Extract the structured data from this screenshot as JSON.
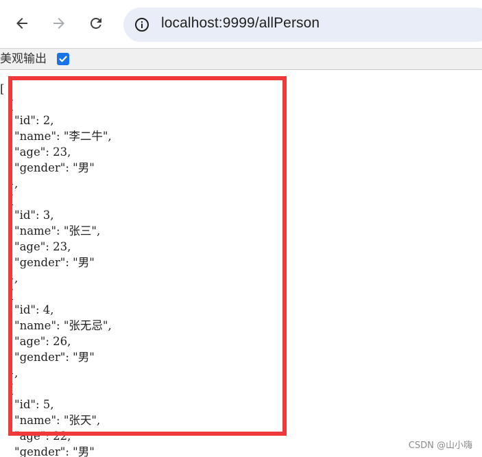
{
  "browser": {
    "url": "localhost:9999/allPerson",
    "back_icon": "arrow-left-icon",
    "forward_icon": "arrow-right-icon",
    "reload_icon": "reload-icon",
    "site_info_icon": "info-circle-icon"
  },
  "pretty_print": {
    "label": "美观输出",
    "checked": true,
    "accent_color": "#1a73e8"
  },
  "json_content": "[\n  {\n    \"id\": 2,\n    \"name\": \"李二牛\",\n    \"age\": 23,\n    \"gender\": \"男\"\n  },\n  {\n    \"id\": 3,\n    \"name\": \"张三\",\n    \"age\": 23,\n    \"gender\": \"男\"\n  },\n  {\n    \"id\": 4,\n    \"name\": \"张无忌\",\n    \"age\": 26,\n    \"gender\": \"男\"\n  },\n  {\n    \"id\": 5,\n    \"name\": \"张天\",\n    \"age\": 22,\n    \"gender\": \"男\"",
  "highlight_color": "#f0393b",
  "watermark": "CSDN @山小嗨"
}
